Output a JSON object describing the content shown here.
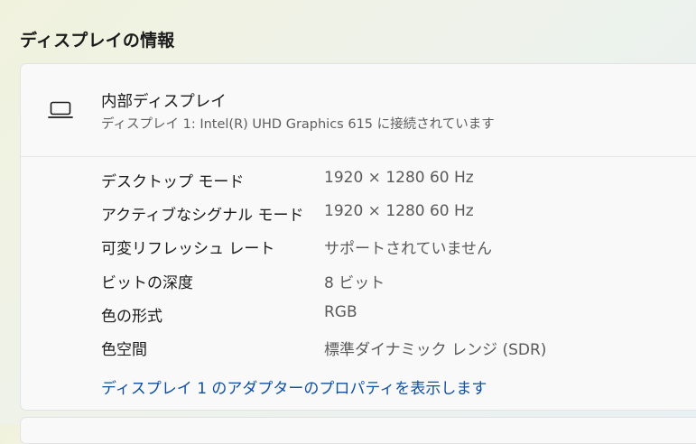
{
  "section_title": "ディスプレイの情報",
  "display": {
    "icon": "laptop-icon",
    "name": "内部ディスプレイ",
    "subtitle": "ディスプレイ 1: Intel(R) UHD Graphics 615 に接続されています"
  },
  "properties": [
    {
      "label": "デスクトップ モード",
      "value": "1920 × 1280 60 Hz"
    },
    {
      "label": "アクティブなシグナル モード",
      "value": "1920 × 1280 60 Hz"
    },
    {
      "label": "可変リフレッシュ レート",
      "value": "サポートされていません"
    },
    {
      "label": "ビットの深度",
      "value": "8 ビット"
    },
    {
      "label": "色の形式",
      "value": "RGB"
    },
    {
      "label": "色空間",
      "value": "標準ダイナミック レンジ (SDR)"
    }
  ],
  "adapter_link": "ディスプレイ 1 のアダプターのプロパティを表示します",
  "colors": {
    "link": "#0f4f9e",
    "card_background": "#f9f9f9",
    "secondary_text": "#5a5a5a"
  }
}
